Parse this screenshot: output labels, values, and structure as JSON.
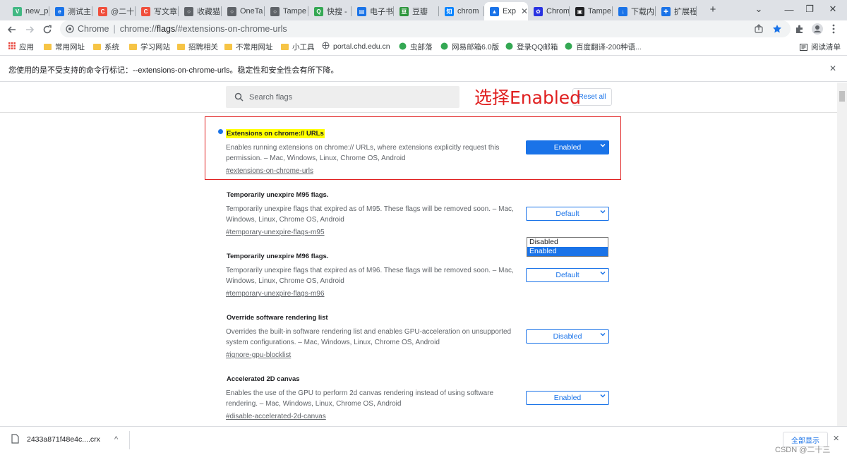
{
  "tabs": [
    {
      "label": "new_p",
      "favicon_color": "#41b883",
      "favicon_glyph": "V"
    },
    {
      "label": "测试主",
      "favicon_color": "#1a73e8",
      "favicon_glyph": "e"
    },
    {
      "label": "@二十",
      "favicon_color": "#f04f3c",
      "favicon_glyph": "C"
    },
    {
      "label": "写文章",
      "favicon_color": "#f04f3c",
      "favicon_glyph": "C"
    },
    {
      "label": "收藏猫",
      "favicon_color": "#5f6368",
      "favicon_glyph": "○"
    },
    {
      "label": "OneTa",
      "favicon_color": "#5f6368",
      "favicon_glyph": "○"
    },
    {
      "label": "Tampe",
      "favicon_color": "#5f6368",
      "favicon_glyph": "○"
    },
    {
      "label": "快搜 -",
      "favicon_color": "#34a853",
      "favicon_glyph": "Q"
    },
    {
      "label": "电子书",
      "favicon_color": "#1a73e8",
      "favicon_glyph": "▤"
    },
    {
      "label": "豆瓣",
      "favicon_color": "#2e963d",
      "favicon_glyph": "豆"
    },
    {
      "label": "chrom",
      "favicon_color": "#0a84ff",
      "favicon_glyph": "知"
    },
    {
      "label": "Exp",
      "favicon_color": "#1a73e8",
      "favicon_glyph": "▲",
      "active": true
    },
    {
      "label": "Chrom",
      "favicon_color": "#2932e1",
      "favicon_glyph": "✿"
    },
    {
      "label": "Tampe",
      "favicon_color": "#202124",
      "favicon_glyph": "▣"
    },
    {
      "label": "下载内",
      "favicon_color": "#1a73e8",
      "favicon_glyph": "↓"
    },
    {
      "label": "扩展程",
      "favicon_color": "#1a73e8",
      "favicon_glyph": "✚"
    }
  ],
  "new_tab_label": "+",
  "window_controls": {
    "tab_search": "⌄",
    "minimize": "—",
    "maximize": "❐",
    "close": "✕"
  },
  "omnibox": {
    "scheme": "Chrome",
    "pipe": "|",
    "url_prefix": "chrome://",
    "url_host": "flags",
    "url_rest": "/#extensions-on-chrome-urls"
  },
  "bookmarks": [
    {
      "label": "应用",
      "icon": "apps-grid-icon"
    },
    {
      "label": "常用网址",
      "icon": "folder-icon"
    },
    {
      "label": "系统",
      "icon": "folder-icon"
    },
    {
      "label": "学习网站",
      "icon": "folder-icon"
    },
    {
      "label": "招聘相关",
      "icon": "folder-icon"
    },
    {
      "label": "不常用网址",
      "icon": "folder-icon"
    },
    {
      "label": "小工具",
      "icon": "folder-icon"
    },
    {
      "label": "portal.chd.edu.cn",
      "icon": "globe-icon"
    },
    {
      "label": "虫部落",
      "icon": "site-icon"
    },
    {
      "label": "网易邮箱6.0版",
      "icon": "site-icon"
    },
    {
      "label": "登录QQ邮箱",
      "icon": "site-icon"
    },
    {
      "label": "百度翻译-200种语...",
      "icon": "site-icon"
    }
  ],
  "reading_list": "阅读清单",
  "infobar": {
    "message": "您使用的是不受支持的命令行标记：--extensions-on-chrome-urls。稳定性和安全性会有所下降。",
    "close": "✕"
  },
  "flags_page": {
    "search_placeholder": "Search flags",
    "reset_all": "Reset all",
    "annotation": "选择Enabled",
    "flags": [
      {
        "title": "Extensions on chrome:// URLs",
        "description": "Enables running extensions on chrome:// URLs, where extensions explicitly request this permission. – Mac, Windows, Linux, Chrome OS, Android",
        "link": "#extensions-on-chrome-urls",
        "value": "Enabled",
        "highlighted": true
      },
      {
        "title": "Temporarily unexpire M95 flags.",
        "description": "Temporarily unexpire flags that expired as of M95. These flags will be removed soon. – Mac, Windows, Linux, Chrome OS, Android",
        "link": "#temporary-unexpire-flags-m95",
        "value": "Default"
      },
      {
        "title": "Temporarily unexpire M96 flags.",
        "description": "Temporarily unexpire flags that expired as of M96. These flags will be removed soon. – Mac, Windows, Linux, Chrome OS, Android",
        "link": "#temporary-unexpire-flags-m96",
        "value": "Default"
      },
      {
        "title": "Override software rendering list",
        "description": "Overrides the built-in software rendering list and enables GPU-acceleration on unsupported system configurations. – Mac, Windows, Linux, Chrome OS, Android",
        "link": "#ignore-gpu-blocklist",
        "value": "Disabled"
      },
      {
        "title": "Accelerated 2D canvas",
        "description": "Enables the use of the GPU to perform 2d canvas rendering instead of using software rendering. – Mac, Windows, Linux, Chrome OS, Android",
        "link": "#disable-accelerated-2d-canvas",
        "value": "Enabled"
      }
    ],
    "dropdown_options": [
      "Disabled",
      "Enabled"
    ],
    "dropdown_selected": "Enabled"
  },
  "download_shelf": {
    "file_name": "2433a871f48e4c....crx",
    "menu_chevron": "^",
    "show_all": "全部显示",
    "close": "✕"
  },
  "watermark": "CSDN @二十三",
  "colors": {
    "accent": "#1a73e8",
    "annotation_red": "#e02020",
    "highlight": "#ffff00"
  }
}
